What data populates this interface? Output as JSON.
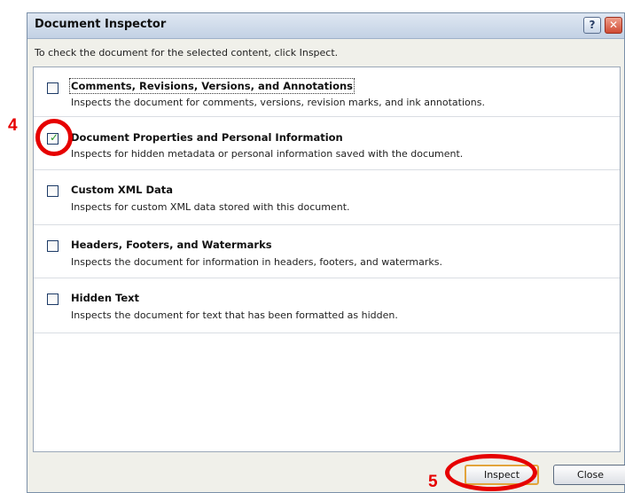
{
  "dialog": {
    "title": "Document Inspector",
    "help_label": "?",
    "close_label": "✕",
    "instruction": "To check the document for the selected content, click Inspect."
  },
  "items": [
    {
      "title": "Comments, Revisions, Versions, and Annotations",
      "description": "Inspects the document for comments, versions, revision marks, and ink annotations.",
      "checked": false
    },
    {
      "title": "Document Properties and Personal Information",
      "description": "Inspects for hidden metadata or personal information saved with the document.",
      "checked": true
    },
    {
      "title": "Custom XML Data",
      "description": "Inspects for custom XML data stored with this document.",
      "checked": false
    },
    {
      "title": "Headers, Footers, and Watermarks",
      "description": "Inspects the document for information in headers, footers, and watermarks.",
      "checked": false
    },
    {
      "title": "Hidden Text",
      "description": "Inspects the document for text that has been formatted as hidden.",
      "checked": false
    }
  ],
  "buttons": {
    "inspect": "Inspect",
    "close": "Close"
  },
  "annotations": {
    "step4": "4",
    "step5": "5",
    "color": "#e60000"
  },
  "check_glyph": "✓"
}
